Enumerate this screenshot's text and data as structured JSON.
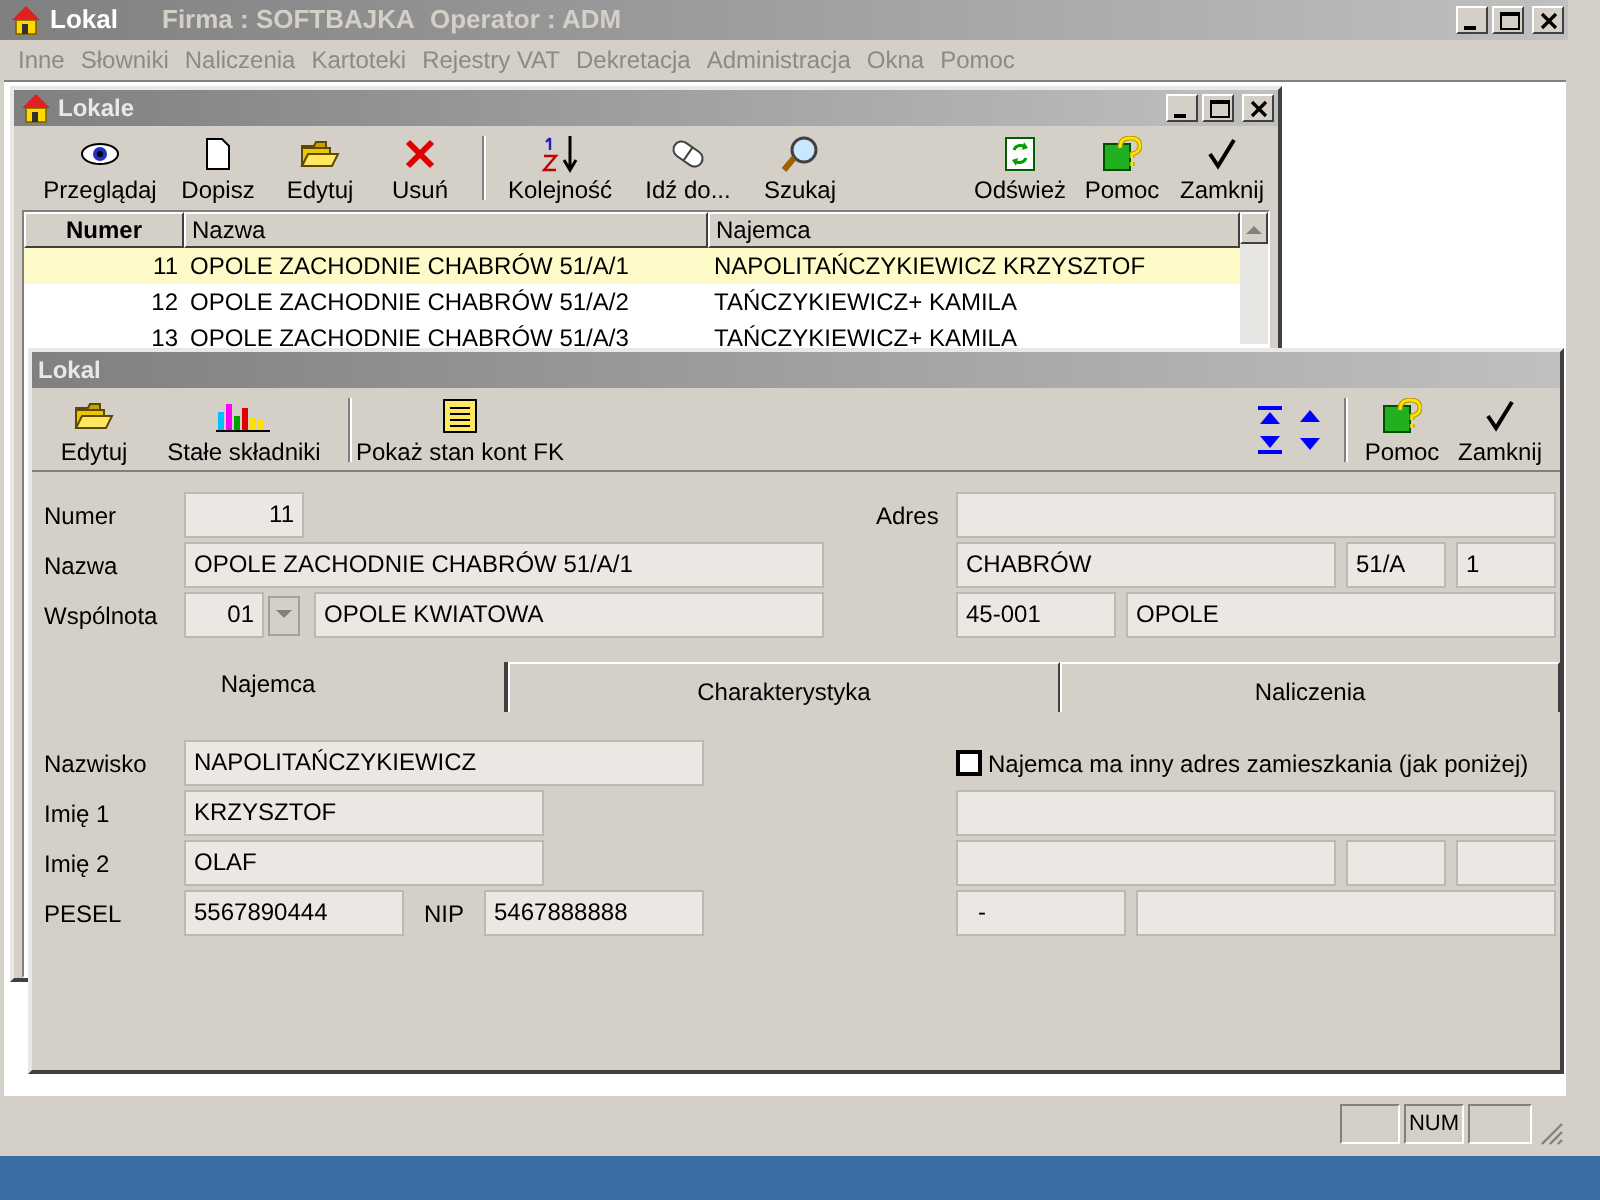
{
  "app": {
    "title": "Lokal",
    "company": "Firma : SOFTBAJKA",
    "operator": "Operator : ADM"
  },
  "menu": [
    {
      "label": "Inne",
      "disabled": true
    },
    {
      "label": "Słowniki",
      "disabled": true
    },
    {
      "label": "Naliczenia",
      "disabled": true
    },
    {
      "label": "Kartoteki",
      "disabled": true
    },
    {
      "label": "Rejestry VAT",
      "disabled": true
    },
    {
      "label": "Dekretacja",
      "disabled": true
    },
    {
      "label": "Administracja",
      "disabled": true
    },
    {
      "label": "Okna",
      "disabled": true
    },
    {
      "label": "Pomoc",
      "disabled": true
    }
  ],
  "list_window": {
    "title": "Lokale",
    "toolbar_left": [
      {
        "label": "Przeglądaj",
        "kind": "eye"
      },
      {
        "label": "Dopisz",
        "kind": "page"
      },
      {
        "label": "Edytuj",
        "kind": "folder"
      },
      {
        "label": "Usuń",
        "kind": "cross"
      }
    ],
    "toolbar_middle": [
      {
        "label": "Kolejność",
        "kind": "sort"
      },
      {
        "label": "Idź do...",
        "kind": "capsule"
      },
      {
        "label": "Szukaj",
        "kind": "search"
      }
    ],
    "toolbar_right": [
      {
        "label": "Odśwież",
        "kind": "refresh"
      },
      {
        "label": "Pomoc",
        "kind": "help"
      },
      {
        "label": "Zamknij",
        "kind": "check"
      }
    ],
    "columns": [
      "Numer",
      "Nazwa",
      "Najemca"
    ],
    "rows": [
      {
        "cells": [
          "11",
          "OPOLE ZACHODNIE CHABRÓW 51/A/1",
          "NAPOLITAŃCZYKIEWICZ KRZYSZTOF"
        ],
        "selected": true
      },
      {
        "cells": [
          "12",
          "OPOLE ZACHODNIE CHABRÓW 51/A/2",
          "TAŃCZYKIEWICZ+ KAMILA"
        ],
        "selected": false
      },
      {
        "cells": [
          "13",
          "OPOLE ZACHODNIE CHABRÓW 51/A/3",
          "TAŃCZYKIEWICZ+ KAMILA"
        ],
        "selected": false
      }
    ]
  },
  "detail_window": {
    "title": "Lokal",
    "toolbar_left": [
      {
        "label": "Edytuj",
        "kind": "folder"
      },
      {
        "label": "Stałe składniki",
        "kind": "chart"
      },
      {
        "label": "Pokaż stan kont FK",
        "kind": "ledger"
      }
    ],
    "toolbar_right": [
      {
        "label": "Pomoc",
        "kind": "help"
      },
      {
        "label": "Zamknij",
        "kind": "check"
      }
    ],
    "numer_label": "Numer",
    "numer": "11",
    "nazwa_label": "Nazwa",
    "nazwa": "OPOLE ZACHODNIE CHABRÓW 51/A/1",
    "wspolnota_label": "Wspólnota",
    "wspolnota_code": "01",
    "wspolnota_name": "OPOLE KWIATOWA",
    "adres_label": "Adres",
    "street": "CHABRÓW",
    "building": "51/A",
    "flat": "1",
    "postal_code": "45-001",
    "city": "OPOLE",
    "tabs": [
      {
        "label": "Najemca",
        "selected": true
      },
      {
        "label": "Charakterystyka",
        "selected": false
      },
      {
        "label": "Naliczenia",
        "selected": false
      }
    ],
    "tenant": {
      "surname_label": "Nazwisko",
      "surname": "NAPOLITAŃCZYKIEWICZ",
      "first_name_label": "Imię 1",
      "first_name": "KRZYSZTOF",
      "second_name_label": "Imię 2",
      "second_name": "OLAF",
      "pesel_label": "PESEL",
      "pesel": "5567890444",
      "nip_label": "NIP",
      "nip": "5467888888",
      "other_address": {
        "label": "Najemca ma inny adres zamieszkania (jak poniżej)",
        "checked": false
      },
      "other_postal_code": "-"
    }
  },
  "status_bar": {
    "num": "NUM"
  }
}
